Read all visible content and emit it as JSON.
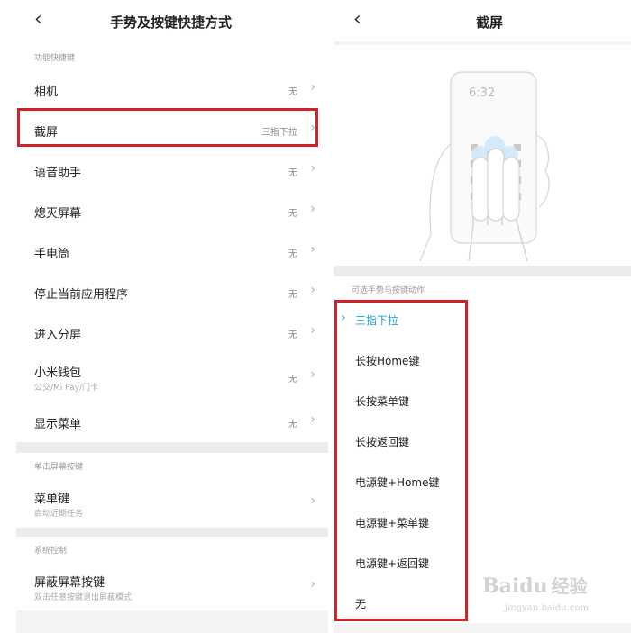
{
  "left": {
    "title": "手势及按键快捷方式",
    "section_function": "功能快捷键",
    "items": [
      {
        "label": "相机",
        "value": "无"
      },
      {
        "label": "截屏",
        "value": "三指下拉"
      },
      {
        "label": "语音助手",
        "value": "无"
      },
      {
        "label": "熄灭屏幕",
        "value": "无"
      },
      {
        "label": "手电筒",
        "value": "无"
      },
      {
        "label": "停止当前应用程序",
        "value": "无"
      },
      {
        "label": "进入分屏",
        "value": "无"
      },
      {
        "label": "小米钱包",
        "sub": "公交/Mi Pay/门卡",
        "value": "无"
      },
      {
        "label": "显示菜单",
        "value": "无"
      }
    ],
    "section_single": "单击屏幕按键",
    "menu_key": {
      "label": "菜单键",
      "sub": "启动近期任务"
    },
    "section_system": "系统控制",
    "block_keys": {
      "label": "屏蔽屏幕按键",
      "sub": "双击任意按键退出屏蔽模式"
    }
  },
  "right": {
    "title": "截屏",
    "illustration_time": "6:32",
    "section_options": "可选手势与按键动作",
    "options": [
      {
        "label": "三指下拉",
        "selected": true
      },
      {
        "label": "长按Home键",
        "selected": false
      },
      {
        "label": "长按菜单键",
        "selected": false
      },
      {
        "label": "长按返回键",
        "selected": false
      },
      {
        "label": "电源键+Home键",
        "selected": false
      },
      {
        "label": "电源键+菜单键",
        "selected": false
      },
      {
        "label": "电源键+返回键",
        "selected": false
      },
      {
        "label": "无",
        "selected": false
      }
    ]
  },
  "icons": {
    "back": "chevron-left-icon",
    "forward": "chevron-right-icon",
    "check": "chevron-right-icon"
  },
  "colors": {
    "accent": "#1aa0dc",
    "highlight": "#d0242b"
  },
  "watermark": {
    "brand": "Baidu",
    "chinese": "经验",
    "url": "jingyan.baidu.com"
  }
}
